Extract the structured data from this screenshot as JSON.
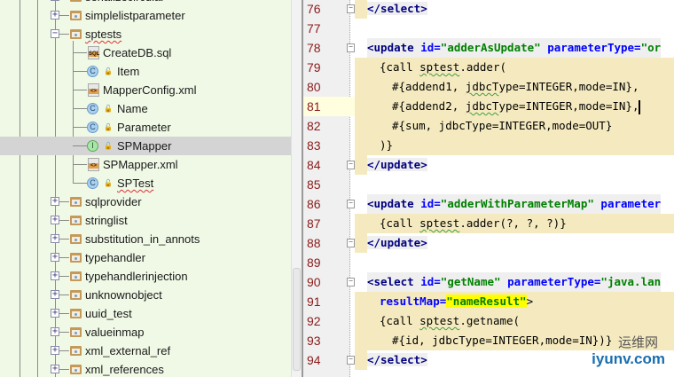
{
  "tree": {
    "items": [
      {
        "label": "serializecircular",
        "kind": "folder",
        "level": 1,
        "expanded": false
      },
      {
        "label": "simplelistparameter",
        "kind": "folder",
        "level": 1,
        "expanded": false
      },
      {
        "label": "sptests",
        "kind": "folder",
        "level": 1,
        "expanded": true,
        "squiggle": true
      },
      {
        "label": "CreateDB.sql",
        "kind": "sql",
        "level": 2
      },
      {
        "label": "Item",
        "kind": "class",
        "level": 2
      },
      {
        "label": "MapperConfig.xml",
        "kind": "xml",
        "level": 2
      },
      {
        "label": "Name",
        "kind": "class",
        "level": 2
      },
      {
        "label": "Parameter",
        "kind": "class",
        "level": 2
      },
      {
        "label": "SPMapper",
        "kind": "interface",
        "level": 2,
        "selected": true
      },
      {
        "label": "SPMapper.xml",
        "kind": "xml",
        "level": 2
      },
      {
        "label": "SPTest",
        "kind": "class",
        "level": 2,
        "squiggle": true,
        "last": true
      },
      {
        "label": "sqlprovider",
        "kind": "folder",
        "level": 1,
        "expanded": false
      },
      {
        "label": "stringlist",
        "kind": "folder",
        "level": 1,
        "expanded": false
      },
      {
        "label": "substitution_in_annots",
        "kind": "folder",
        "level": 1,
        "expanded": false
      },
      {
        "label": "typehandler",
        "kind": "folder",
        "level": 1,
        "expanded": false
      },
      {
        "label": "typehandlerinjection",
        "kind": "folder",
        "level": 1,
        "expanded": false
      },
      {
        "label": "unknownobject",
        "kind": "folder",
        "level": 1,
        "expanded": false
      },
      {
        "label": "uuid_test",
        "kind": "folder",
        "level": 1,
        "expanded": false
      },
      {
        "label": "valueinmap",
        "kind": "folder",
        "level": 1,
        "expanded": false
      },
      {
        "label": "xml_external_ref",
        "kind": "folder",
        "level": 1,
        "expanded": false
      },
      {
        "label": "xml_references",
        "kind": "folder",
        "level": 1,
        "expanded": false
      }
    ],
    "sql_icon_text": "SQL",
    "xml_icon_text": "<>",
    "class_icon_text": "C",
    "interface_icon_text": "I"
  },
  "editor": {
    "current_line": 81,
    "lines": [
      {
        "n": "76",
        "fold": true,
        "bg": "tag",
        "indent": 0,
        "segs": [
          [
            "tag",
            "</select>"
          ]
        ]
      },
      {
        "n": "77",
        "segs": []
      },
      {
        "n": "78",
        "fold": true,
        "indent": 0,
        "segs": [
          [
            "tag",
            "<update"
          ],
          [
            "plain",
            " "
          ],
          [
            "attr",
            "id="
          ],
          [
            "val",
            "\"adderAsUpdate\""
          ],
          [
            "plain",
            " "
          ],
          [
            "attr",
            "parameterType="
          ],
          [
            "val",
            "\"or"
          ]
        ]
      },
      {
        "n": "79",
        "bg": "tan",
        "indent": 1,
        "segs": [
          [
            "plain",
            "{call "
          ],
          [
            "wavy",
            "sptest"
          ],
          [
            "plain",
            ".adder("
          ]
        ]
      },
      {
        "n": "80",
        "bg": "tan",
        "indent": 2,
        "segs": [
          [
            "plain",
            "#{addend1, "
          ],
          [
            "wavy",
            "jdbcT"
          ],
          [
            "plain",
            "ype=INTEGER,mode=IN},"
          ]
        ]
      },
      {
        "n": "81",
        "bg": "tan",
        "indent": 2,
        "caret": true,
        "segs": [
          [
            "plain",
            "#{addend2, "
          ],
          [
            "wavy",
            "jdbcT"
          ],
          [
            "plain",
            "ype=INTEGER,mode=IN},"
          ]
        ]
      },
      {
        "n": "82",
        "bg": "tan",
        "indent": 2,
        "segs": [
          [
            "plain",
            "#{sum, jdbcType=INTEGER,mode=OUT}"
          ]
        ]
      },
      {
        "n": "83",
        "bg": "tan",
        "indent": 1,
        "segs": [
          [
            "plain",
            ")}"
          ]
        ]
      },
      {
        "n": "84",
        "fold": true,
        "bg": "tagonly",
        "indent": 0,
        "segs": [
          [
            "tag",
            "</update>"
          ]
        ]
      },
      {
        "n": "85",
        "segs": []
      },
      {
        "n": "86",
        "fold": true,
        "indent": 0,
        "segs": [
          [
            "tag",
            "<update"
          ],
          [
            "plain",
            " "
          ],
          [
            "attr",
            "id="
          ],
          [
            "val",
            "\"adderWithParameterMap\""
          ],
          [
            "plain",
            " "
          ],
          [
            "attr",
            "parameter"
          ]
        ]
      },
      {
        "n": "87",
        "bg": "tan",
        "indent": 1,
        "segs": [
          [
            "plain",
            "{call "
          ],
          [
            "wavy",
            "sptest"
          ],
          [
            "plain",
            ".adder(?, ?, ?)}"
          ]
        ]
      },
      {
        "n": "88",
        "fold": true,
        "bg": "tagonly",
        "indent": 0,
        "segs": [
          [
            "tag",
            "</update>"
          ]
        ]
      },
      {
        "n": "89",
        "segs": []
      },
      {
        "n": "90",
        "fold": true,
        "indent": 0,
        "segs": [
          [
            "tag",
            "<select"
          ],
          [
            "plain",
            " "
          ],
          [
            "attr",
            "id="
          ],
          [
            "val",
            "\"getName\""
          ],
          [
            "plain",
            " "
          ],
          [
            "attr",
            "parameterType="
          ],
          [
            "val",
            "\"java.lan"
          ]
        ]
      },
      {
        "n": "91",
        "bg": "tan",
        "indent": 1,
        "segs": [
          [
            "attr",
            "resultMap="
          ],
          [
            "valhl",
            "\"nameResult\""
          ],
          [
            "plain",
            ">"
          ]
        ]
      },
      {
        "n": "92",
        "bg": "tan",
        "indent": 1,
        "segs": [
          [
            "plain",
            "{call "
          ],
          [
            "wavy",
            "sptest"
          ],
          [
            "plain",
            ".getname("
          ]
        ]
      },
      {
        "n": "93",
        "bg": "tan",
        "indent": 2,
        "segs": [
          [
            "plain",
            "#{id, jdbcType=INTEGER,mode=IN})}"
          ]
        ]
      },
      {
        "n": "94",
        "fold": true,
        "bg": "tagonly",
        "indent": 0,
        "segs": [
          [
            "tag",
            "</select>"
          ]
        ]
      }
    ]
  },
  "watermark": {
    "line1": "运维网",
    "line2": "iyunv.com"
  }
}
